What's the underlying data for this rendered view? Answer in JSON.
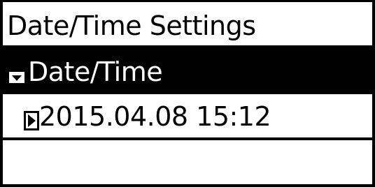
{
  "screen": {
    "title": "Date/Time Settings"
  },
  "menu": {
    "selected_item": {
      "label": "Date/Time",
      "icon": "expand-triangle-icon"
    },
    "value_item": {
      "label": "2015.04.08  15:12",
      "icon": "right-arrow-icon"
    }
  },
  "colors": {
    "background": "#ffffff",
    "foreground": "#000000",
    "highlight": "#000000",
    "highlight_text": "#ffffff"
  }
}
